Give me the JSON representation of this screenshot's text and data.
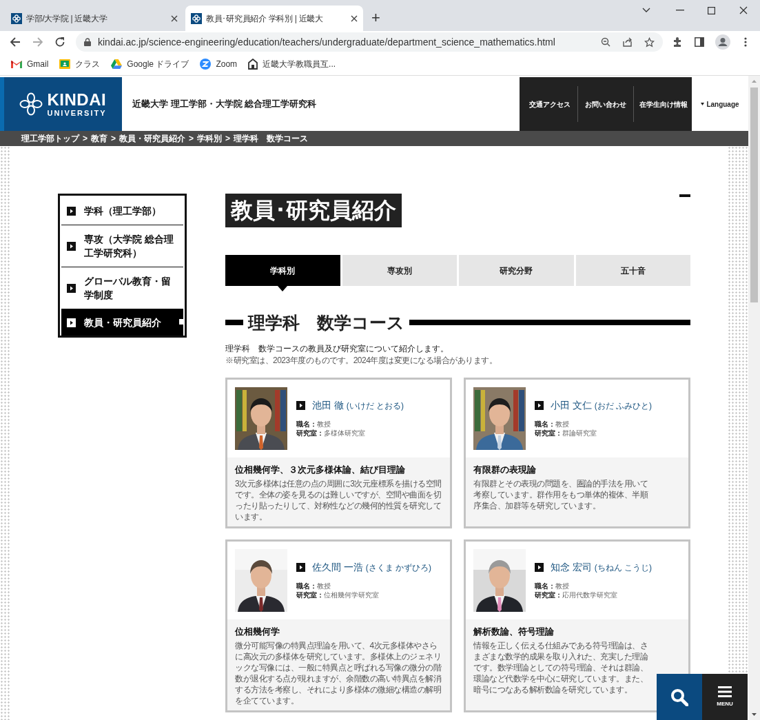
{
  "browser": {
    "tabs": [
      {
        "title": "学部/大学院 | 近畿大学",
        "selected": false
      },
      {
        "title": "教員･研究員紹介 学科別 | 近畿大",
        "selected": true
      }
    ],
    "new_tab": "+",
    "address": "kindai.ac.jp/science-engineering/education/teachers/undergraduate/department_science_mathematics.html",
    "bookmarks": [
      {
        "label": "Gmail",
        "kind": "gmail"
      },
      {
        "label": "クラス",
        "kind": "classroom"
      },
      {
        "label": "Google ドライブ",
        "kind": "drive"
      },
      {
        "label": "Zoom",
        "kind": "zoom"
      },
      {
        "label": "近畿大学教職員互...",
        "kind": "page"
      }
    ]
  },
  "header": {
    "logo_top": "KINDAI",
    "logo_bottom": "UNIVERSITY",
    "site_title": "近畿大学 理工学部・大学院 総合理工学研究科",
    "nav": [
      "交通アクセス",
      "お問い合わせ",
      "在学生向け情報"
    ],
    "language": "Language"
  },
  "breadcrumb": {
    "separator": ">",
    "items": [
      "理工学部トップ",
      "教育",
      "教員・研究員紹介",
      "学科別",
      "理学科　数学コース"
    ]
  },
  "sidebar": {
    "items": [
      {
        "label": "学科（理工学部）",
        "selected": false
      },
      {
        "label": "専攻（大学院 総合理工学研究科）",
        "selected": false
      },
      {
        "label": "グローバル教育・留学制度",
        "selected": false
      },
      {
        "label": "教員・研究員紹介",
        "selected": true
      }
    ]
  },
  "page_title": "教員･研究員紹介",
  "tabs": [
    {
      "label": "学科別",
      "selected": true
    },
    {
      "label": "専攻別",
      "selected": false
    },
    {
      "label": "研究分野",
      "selected": false
    },
    {
      "label": "五十音",
      "selected": false
    }
  ],
  "section_title": "理学科　数学コース",
  "intro": "理学科　数学コースの教員及び研究室について紹介します。",
  "note": "※研究室は、2023年度のものです。2024年度は変更になる場合があります。",
  "cards": [
    {
      "name": "池田 徹",
      "reading": "(いけだ とおる)",
      "position_label": "職名：",
      "position": "教授",
      "lab_label": "研究室：",
      "lab": "多様体研究室",
      "topic": "位相幾何学、３次元多様体論、結び目理論",
      "description": "3次元多様体は任意の点の周囲に3次元座標系を描ける空間です。全体の姿を見るのは難しいですが、空間や曲面を切ったり貼ったりして、対称性などの幾何的性質を研究しています。"
    },
    {
      "name": "小田 文仁",
      "reading": "(おだ ふみひと)",
      "position_label": "職名：",
      "position": "教授",
      "lab_label": "研究室：",
      "lab": "群論研究室",
      "topic": "有限群の表現論",
      "description": "有限群とその表現の問題を、圏論的手法を用いて考察しています。群作用をもつ単体的複体、半順序集合、加群等を研究しています。"
    },
    {
      "name": "佐久間 一浩",
      "reading": "(さくま かずひろ)",
      "position_label": "職名：",
      "position": "教授",
      "lab_label": "研究室：",
      "lab": "位相幾何学研究室",
      "topic": "位相幾何学",
      "description": "微分可能写像の特異点理論を用いて、4次元多様体やさらに高次元の多様体を研究しています。多様体上のジェネリックな写像には、一般に特異点と呼ばれる写像の微分の階数が退化する点が現れますが、余階数の高い特異点を解消する方法を考察し、それにより多様体の微細な構造の解明を企てています。"
    },
    {
      "name": "知念 宏司",
      "reading": "(ちねん こうじ)",
      "position_label": "職名：",
      "position": "教授",
      "lab_label": "研究室：",
      "lab": "応用代数学研究室",
      "topic": "解析数論、符号理論",
      "description": "情報を正しく伝える仕組みである符号理論は、さまざまな数学的成果を取り入れた、充実した理論です。数学理論としての符号理論、それは群論、環論など代数学を中心に研究しています。また、暗号につなある解析数論を研究しています。"
    }
  ],
  "floating": {
    "menu_label": "MENU"
  }
}
